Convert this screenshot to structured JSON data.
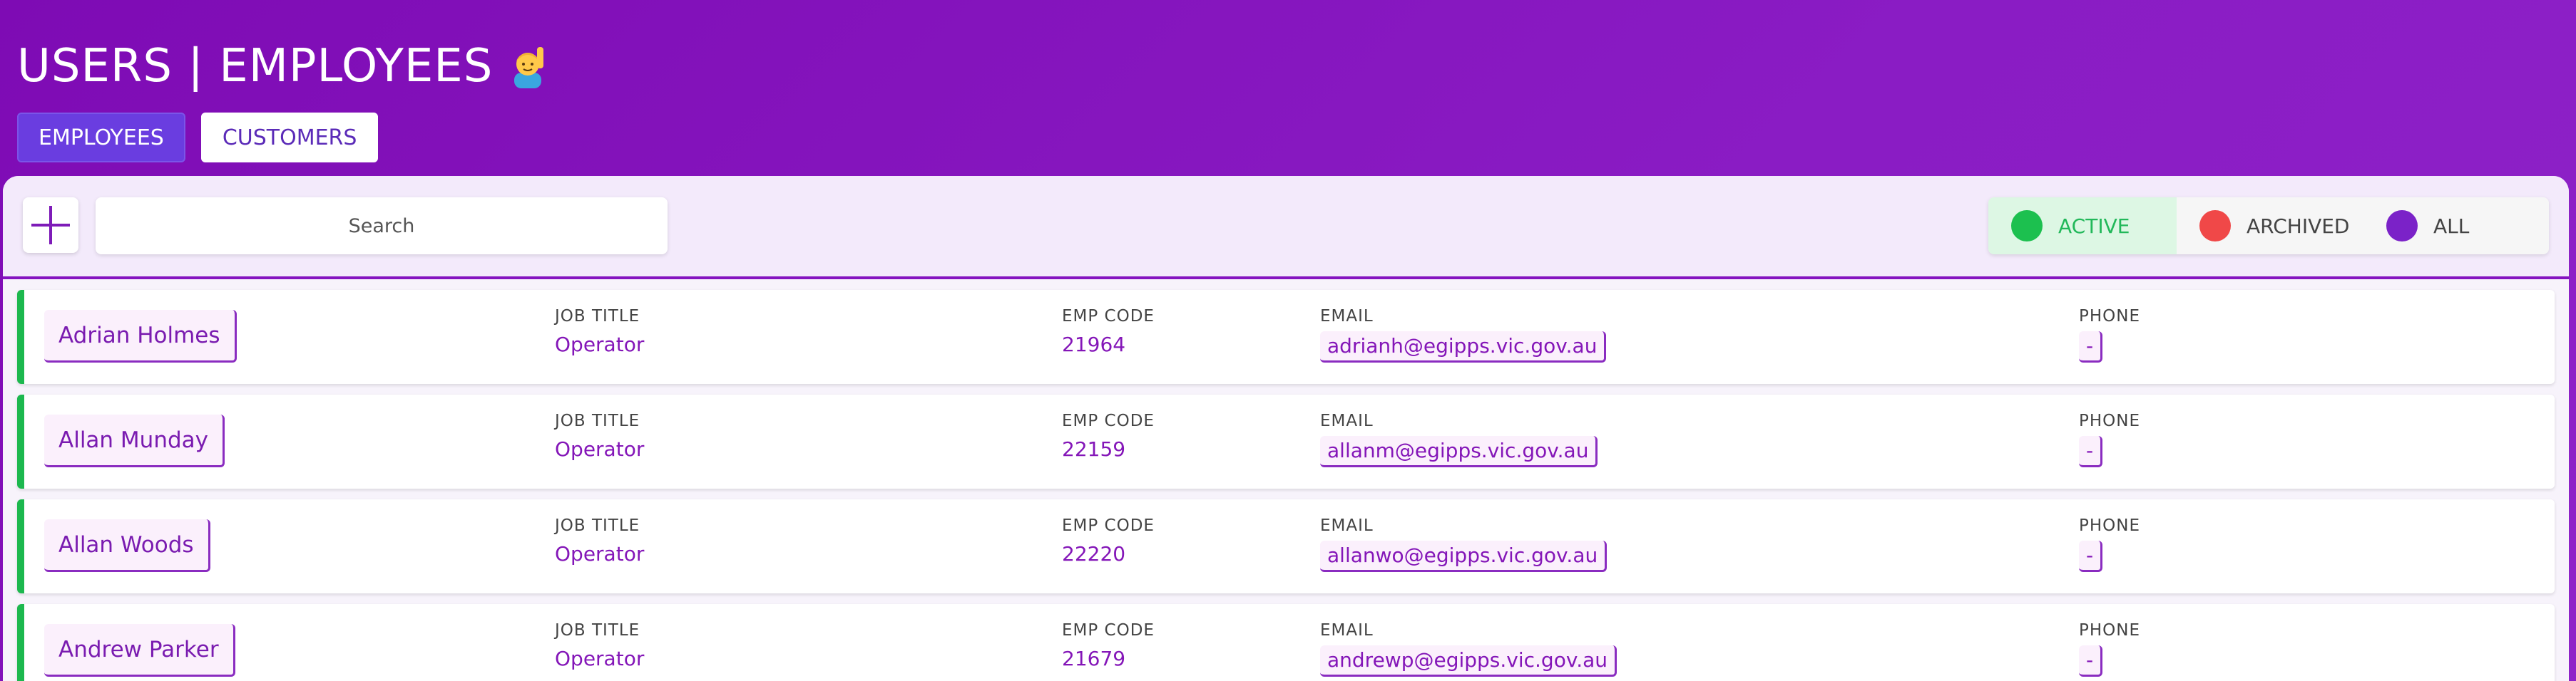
{
  "header": {
    "title": "USERS | EMPLOYEES",
    "title_icon": "person-raising-hand-icon"
  },
  "tabs": [
    {
      "label": "EMPLOYEES",
      "active": true
    },
    {
      "label": "CUSTOMERS",
      "active": false
    }
  ],
  "toolbar": {
    "add_icon": "plus-icon",
    "search_placeholder": "Search",
    "filters": [
      {
        "label": "ACTIVE",
        "color": "#1cc04f",
        "selected": true
      },
      {
        "label": "ARCHIVED",
        "color": "#f04848",
        "selected": false
      },
      {
        "label": "ALL",
        "color": "#7b22c8",
        "selected": false
      }
    ]
  },
  "columns": {
    "job_title": "JOB TITLE",
    "emp_code": "EMP CODE",
    "email": "EMAIL",
    "phone": "PHONE"
  },
  "employees": [
    {
      "name": "Adrian Holmes",
      "job_title": "Operator",
      "emp_code": "21964",
      "email": "adrianh@egipps.vic.gov.au",
      "phone": "-"
    },
    {
      "name": "Allan Munday",
      "job_title": "Operator",
      "emp_code": "22159",
      "email": "allanm@egipps.vic.gov.au",
      "phone": "-"
    },
    {
      "name": "Allan Woods",
      "job_title": "Operator",
      "emp_code": "22220",
      "email": "allanwo@egipps.vic.gov.au",
      "phone": "-"
    },
    {
      "name": "Andrew Parker",
      "job_title": "Operator",
      "emp_code": "21679",
      "email": "andrewp@egipps.vic.gov.au",
      "phone": "-"
    }
  ],
  "colors": {
    "brand": "#8413c0",
    "active_status": "#1cb84e"
  }
}
